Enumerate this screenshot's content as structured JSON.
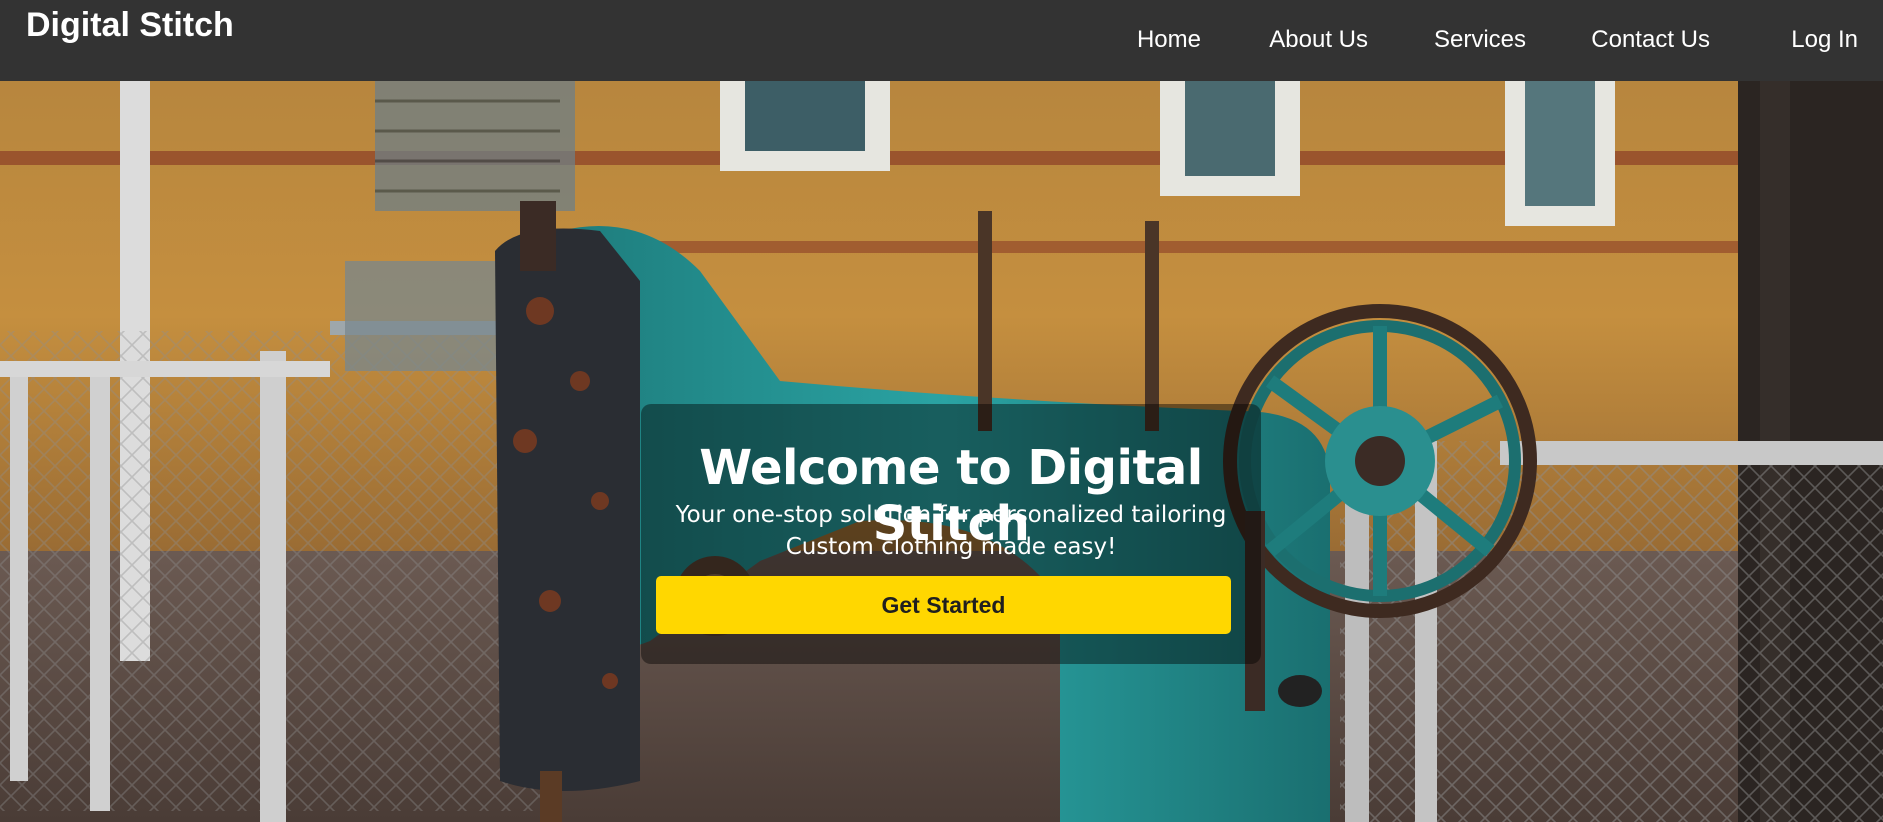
{
  "header": {
    "brand": "Digital Stitch",
    "nav": {
      "home": "Home",
      "about": "About Us",
      "services": "Services",
      "contact": "Contact Us",
      "login": "Log In"
    }
  },
  "hero": {
    "background": "photo-sewing-machine-outdoors",
    "title": "Welcome to Digital Stitch",
    "subtitle_line1": "Your one-stop solution for personalized tailoring",
    "subtitle_line2": "Custom clothing made easy!",
    "cta_label": "Get Started"
  },
  "colors": {
    "header_bg": "#333333",
    "cta_bg": "#ffd700",
    "overlay": "rgba(0,0,0,0.42)"
  }
}
